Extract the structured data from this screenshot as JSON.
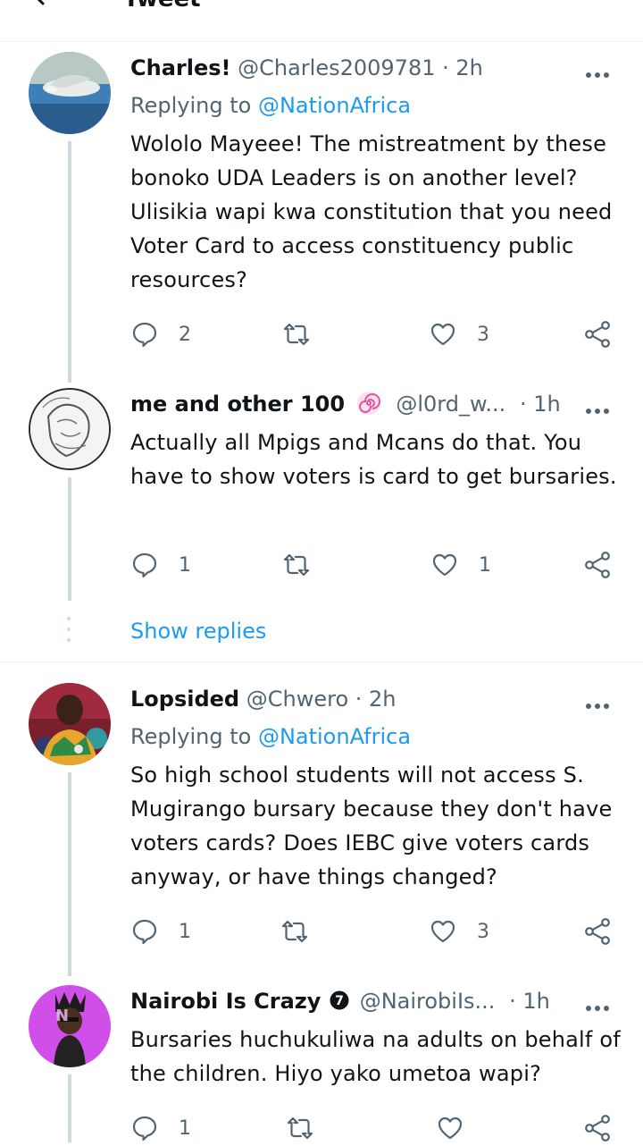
{
  "header": {
    "title": "Tweet"
  },
  "tweets": [
    {
      "name": "Charles!",
      "handle": "@Charles2009781",
      "time": "· 2h",
      "reply_prefix": "Replying to ",
      "reply_to": "@NationAfrica",
      "text": "Wololo Mayeee! The mistreatment by these bonoko UDA Leaders is on another level? Ulisikia wapi kwa constitution that you need Voter Card to access constituency public resources?",
      "replies": "2",
      "retweets": "",
      "likes": "3"
    },
    {
      "name": "me and other 100",
      "handle": "@l0rd_w...",
      "time": "· 1h",
      "text": "Actually all Mpigs and Mcans do that. You have to show voters is card to get bursaries.",
      "replies": "1",
      "retweets": "",
      "likes": "1"
    },
    {
      "name": "Lopsided",
      "handle": "@Chwero",
      "time": "· 2h",
      "reply_prefix": "Replying to ",
      "reply_to": "@NationAfrica",
      "text": "So high school students will not access S. Mugirango bursary because they don't have voters cards? Does IEBC give voters cards anyway, or have things changed?",
      "replies": "1",
      "retweets": "",
      "likes": "3"
    },
    {
      "name": "Nairobi Is Crazy",
      "handle": "@NairobiIs...",
      "time": "· 1h",
      "badge": "7",
      "text": "Bursaries huchukuliwa na adults on behalf of the children. Hiyo yako umetoa wapi?",
      "replies": "1",
      "retweets": "",
      "likes": ""
    }
  ],
  "show_replies": "Show replies",
  "colors": {
    "accent": "#1d9bf0",
    "muted": "#536471",
    "thread": "#cfd9de"
  },
  "icons": [
    "back-arrow-icon",
    "more-icon",
    "reply-icon",
    "retweet-icon",
    "like-icon",
    "share-icon",
    "verified-icon",
    "swirl-emoji-icon"
  ]
}
